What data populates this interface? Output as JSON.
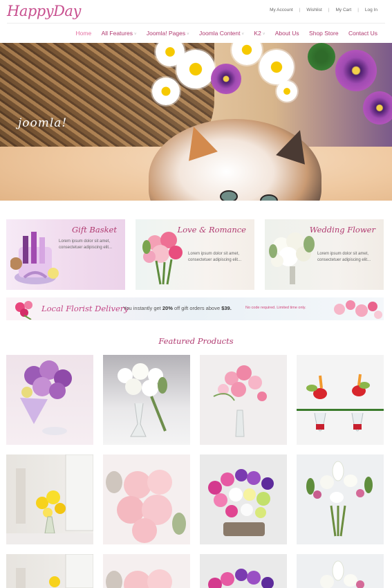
{
  "brand": {
    "logo_text": "HappyDay"
  },
  "top_links": [
    "My Account",
    "Wishlist",
    "My Cart",
    "Log In"
  ],
  "main_nav": [
    {
      "label": "Home",
      "active": true,
      "dropdown": false
    },
    {
      "label": "All Features",
      "active": false,
      "dropdown": true
    },
    {
      "label": "Joomla! Pages",
      "active": false,
      "dropdown": true
    },
    {
      "label": "Joomla Content",
      "active": false,
      "dropdown": true
    },
    {
      "label": "K2",
      "active": false,
      "dropdown": true
    },
    {
      "label": "About Us",
      "active": false,
      "dropdown": false
    },
    {
      "label": "Shop Store",
      "active": false,
      "dropdown": false
    },
    {
      "label": "Contact Us",
      "active": false,
      "dropdown": false
    }
  ],
  "hero": {
    "watermark": "joomla!"
  },
  "promos": [
    {
      "title": "Gift Basket",
      "body": "Lorem ipsum dolor sit amet, consectetuer adipiscing elit..."
    },
    {
      "title": "Love & Romance",
      "body": "Lorem ipsum dolor sit amet, consectetuer adipiscing elit..."
    },
    {
      "title": "Wedding Flower",
      "body": "Lorem ipsum dolor sit amet, consectetuer adipiscing elit..."
    }
  ],
  "delivery_banner": {
    "title": "Local Florist Delivery",
    "text_prefix": "You instantly get ",
    "discount": "20%",
    "text_middle": " off gift orders above ",
    "amount": "$39.",
    "note": "No code required. Limited time only."
  },
  "featured": {
    "heading": "Featured Products",
    "products": [
      {
        "image": "purple-rose-bouquet"
      },
      {
        "image": "white-rose-vase"
      },
      {
        "image": "pink-rose-vase"
      },
      {
        "image": "anthurium-red-vases"
      },
      {
        "image": "yellow-lily-vase"
      },
      {
        "image": "pink-peony-bouquet"
      },
      {
        "image": "mixed-chrysanthemum-basket"
      },
      {
        "image": "white-lily-bouquet"
      },
      {
        "image": "yellow-lily-vase"
      },
      {
        "image": "pink-peony-bouquet"
      },
      {
        "image": "mixed-chrysanthemum-basket"
      },
      {
        "image": "white-lily-bouquet"
      }
    ]
  },
  "colors": {
    "brand_pink": "#c8508f",
    "heading_pink": "#b03a70",
    "active_nav": "#e56fa1"
  }
}
